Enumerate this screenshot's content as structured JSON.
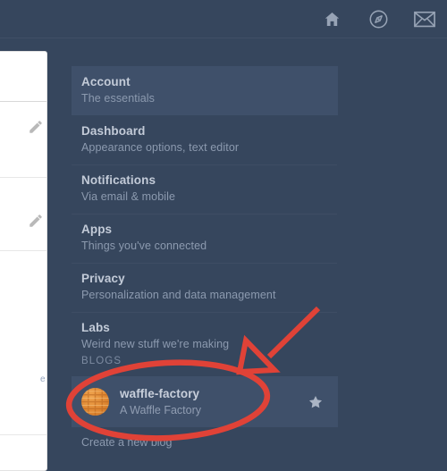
{
  "topbar": {
    "icons": [
      {
        "name": "home-icon",
        "label": "Home"
      },
      {
        "name": "compass-icon",
        "label": "Explore"
      },
      {
        "name": "envelope-icon",
        "label": "Messages"
      }
    ]
  },
  "settings_menu": {
    "items": [
      {
        "title": "Account",
        "subtitle": "The essentials",
        "selected": true
      },
      {
        "title": "Dashboard",
        "subtitle": "Appearance options, text editor",
        "selected": false
      },
      {
        "title": "Notifications",
        "subtitle": "Via email & mobile",
        "selected": false
      },
      {
        "title": "Apps",
        "subtitle": "Things you've connected",
        "selected": false
      },
      {
        "title": "Privacy",
        "subtitle": "Personalization and data management",
        "selected": false
      },
      {
        "title": "Labs",
        "subtitle": "Weird new stuff we're making",
        "selected": false
      }
    ]
  },
  "blogs": {
    "heading": "BLOGS",
    "blog": {
      "name": "waffle-factory",
      "description": "A Waffle Factory",
      "avatar": "waffle-avatar",
      "star": "star-icon"
    },
    "create_label": "Create a new blog"
  },
  "left_panel": {
    "text_snippet": "e"
  },
  "annotation": {
    "color": "#e04237",
    "shapes": [
      "arrow",
      "ellipse"
    ]
  },
  "colors": {
    "background": "#36465d",
    "row_highlight": "#3f506a",
    "title_text": "#c3cbd8",
    "subtitle_text": "#8c9aaf",
    "divider": "#3e4d64",
    "annotation_red": "#e04237",
    "avatar_orange": "#dd8530"
  }
}
